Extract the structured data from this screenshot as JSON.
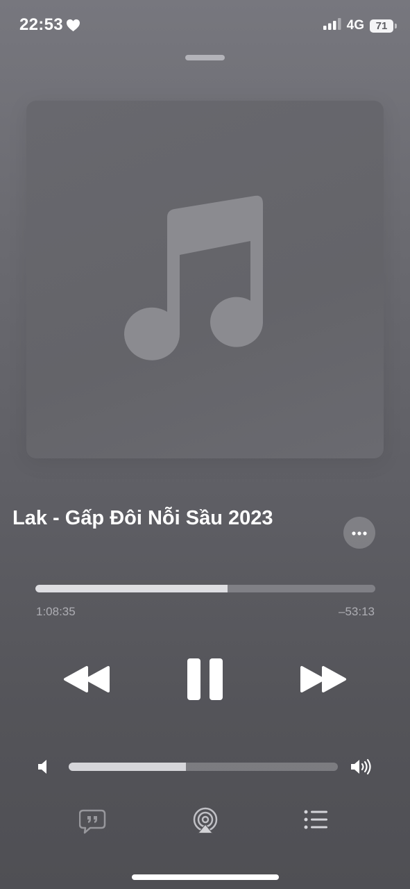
{
  "status_bar": {
    "time": "22:53",
    "network": "4G",
    "battery": "71",
    "battery_level": 0.71
  },
  "now_playing": {
    "title_visible": "Lak - Gấp Đôi Nỗi Sầu 2023",
    "artwork_icon": "music-note-icon",
    "elapsed": "1:08:35",
    "remaining": "–53:13",
    "progress": 0.565
  },
  "controls": {
    "rewind_icon": "rewind-icon",
    "pause_icon": "pause-icon",
    "forward_icon": "fast-forward-icon"
  },
  "volume": {
    "level": 0.436
  },
  "bottom_bar": {
    "lyrics_icon": "lyrics-icon",
    "airplay_icon": "airplay-icon",
    "queue_icon": "queue-icon"
  },
  "colors": {
    "accent": "#ffffff",
    "background_top": "#77777e",
    "background_bottom": "#4f4f54"
  }
}
